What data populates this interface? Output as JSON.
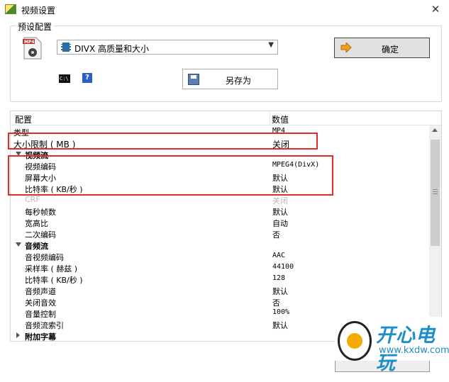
{
  "window": {
    "title": "视频设置"
  },
  "presets": {
    "group_label": "预设配置",
    "selected_preset": "DIVX 高质量和大小",
    "ok_label": "确定",
    "save_as_label": "另存为",
    "icons": {
      "format": "mp4-file-icon",
      "cmd": "cmd-icon",
      "help": "help-icon"
    },
    "cmd_text": "C:\\",
    "help_text": "?"
  },
  "grid": {
    "header": {
      "name": "配置",
      "value": "数值"
    },
    "rows": [
      {
        "name": "类型",
        "value": "MP4",
        "kind": "item"
      },
      {
        "name": "大小限制 ( MB )",
        "value": "关闭",
        "kind": "item"
      },
      {
        "name": "视频流",
        "value": "",
        "kind": "cat"
      },
      {
        "name": "视频编码",
        "value": "MPEG4(DivX)",
        "kind": "sub"
      },
      {
        "name": "屏幕大小",
        "value": "默认",
        "kind": "sub"
      },
      {
        "name": "比特率 ( KB/秒 )",
        "value": "默认",
        "kind": "sub"
      },
      {
        "name": "CRF",
        "value": "关闭",
        "kind": "muted"
      },
      {
        "name": "每秒帧数",
        "value": "默认",
        "kind": "sub"
      },
      {
        "name": "宽高比",
        "value": "自动",
        "kind": "sub"
      },
      {
        "name": "二次编码",
        "value": "否",
        "kind": "sub"
      },
      {
        "name": "音频流",
        "value": "",
        "kind": "cat"
      },
      {
        "name": "音视频编码",
        "value": "AAC",
        "kind": "sub"
      },
      {
        "name": "采样率 ( 赫兹 )",
        "value": "44100",
        "kind": "sub"
      },
      {
        "name": "比特率 ( KB/秒 )",
        "value": "128",
        "kind": "sub"
      },
      {
        "name": "音频声道",
        "value": "默认",
        "kind": "sub"
      },
      {
        "name": "关闭音效",
        "value": "否",
        "kind": "sub"
      },
      {
        "name": "音量控制",
        "value": "100%",
        "kind": "sub"
      },
      {
        "name": "音频流索引",
        "value": "默认",
        "kind": "sub"
      },
      {
        "name": "附加字幕",
        "value": "",
        "kind": "cat-collapsed"
      }
    ]
  },
  "watermark": {
    "brand": "开心电玩",
    "url": "www.kxdw.com"
  },
  "colors": {
    "highlight": "#e42a2a",
    "brand": "#1e8ec8"
  }
}
